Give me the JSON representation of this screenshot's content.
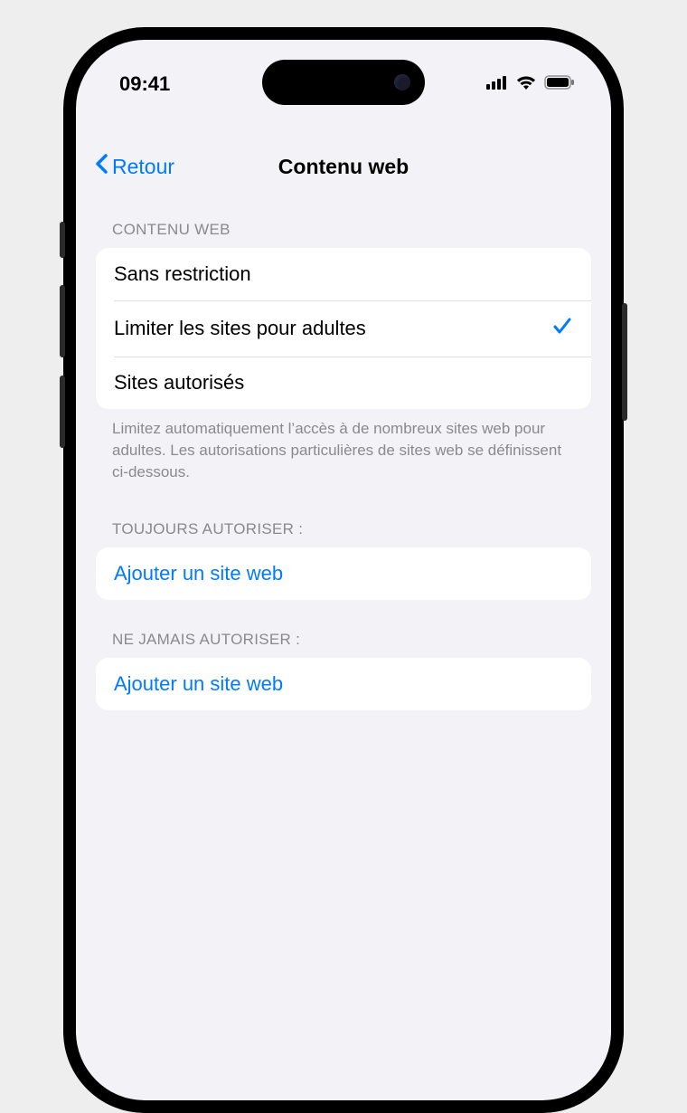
{
  "status": {
    "time": "09:41"
  },
  "nav": {
    "back": "Retour",
    "title": "Contenu web"
  },
  "sections": {
    "webContent": {
      "header": "CONTENU WEB",
      "options": [
        {
          "label": "Sans restriction",
          "selected": false
        },
        {
          "label": "Limiter les sites pour adultes",
          "selected": true
        },
        {
          "label": "Sites autorisés",
          "selected": false
        }
      ],
      "footer": "Limitez automatiquement l’accès à de nombreux sites web pour adultes. Les autorisations particulières de sites web se définissent ci-dessous."
    },
    "alwaysAllow": {
      "header": "TOUJOURS AUTORISER :",
      "addLabel": "Ajouter un site web"
    },
    "neverAllow": {
      "header": "NE JAMAIS AUTORISER :",
      "addLabel": "Ajouter un site web"
    }
  }
}
